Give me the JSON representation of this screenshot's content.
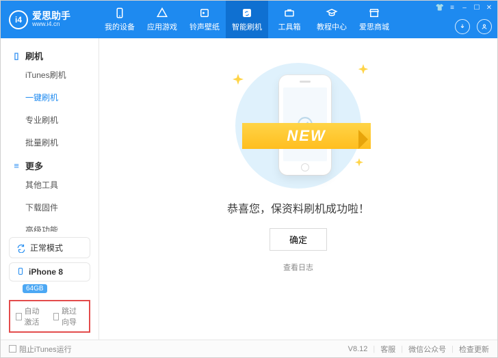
{
  "app": {
    "name_cn": "爱思助手",
    "site": "www.i4.cn",
    "logo_letters": "i4"
  },
  "tabs": [
    {
      "id": "device",
      "label": "我的设备"
    },
    {
      "id": "apps",
      "label": "应用游戏"
    },
    {
      "id": "ringwall",
      "label": "铃声壁纸"
    },
    {
      "id": "flash",
      "label": "智能刷机",
      "active": true
    },
    {
      "id": "toolbox",
      "label": "工具箱"
    },
    {
      "id": "tutorial",
      "label": "教程中心"
    },
    {
      "id": "mall",
      "label": "爱思商城"
    }
  ],
  "sidebar": {
    "groups": [
      {
        "id": "flash-group",
        "label": "刷机",
        "items": [
          {
            "id": "itunes-flash",
            "label": "iTunes刷机"
          },
          {
            "id": "one-key-flash",
            "label": "一键刷机",
            "active": true
          },
          {
            "id": "pro-flash",
            "label": "专业刷机"
          },
          {
            "id": "batch-flash",
            "label": "批量刷机"
          }
        ]
      },
      {
        "id": "more-group",
        "label": "更多",
        "items": [
          {
            "id": "other-tools",
            "label": "其他工具"
          },
          {
            "id": "download-fw",
            "label": "下载固件"
          },
          {
            "id": "advanced",
            "label": "高级功能"
          }
        ]
      }
    ],
    "mode": "正常模式",
    "device": {
      "name": "iPhone 8",
      "storage": "64GB"
    },
    "auto_activate": "自动激活",
    "skip_guide": "跳过向导"
  },
  "main": {
    "ribbon_text": "NEW",
    "success_text": "恭喜您，保资料刷机成功啦！",
    "ok_label": "确定",
    "view_log": "查看日志"
  },
  "footer": {
    "block_itunes": "阻止iTunes运行",
    "version": "V8.12",
    "support": "客服",
    "wechat": "微信公众号",
    "update": "检查更新"
  }
}
